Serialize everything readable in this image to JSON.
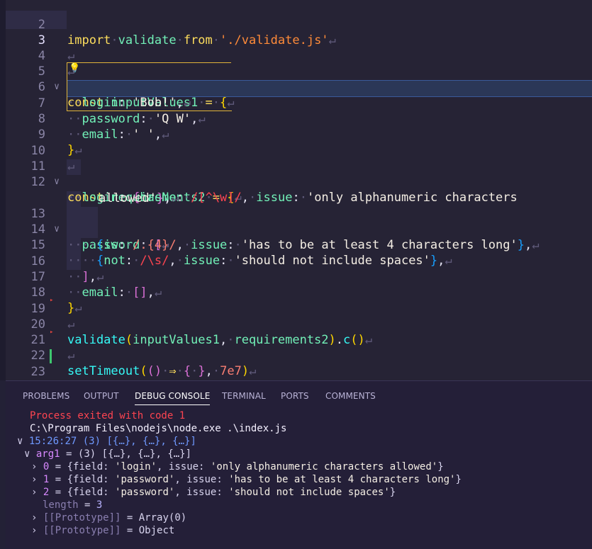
{
  "editor": {
    "lines": [
      {
        "n": "2",
        "html_key": "l2"
      },
      {
        "n": "3",
        "html_key": "l3"
      },
      {
        "n": "4",
        "html_key": "l4"
      },
      {
        "n": "5",
        "html_key": "l5"
      },
      {
        "n": "6",
        "html_key": "l6"
      },
      {
        "n": "7",
        "html_key": "l7"
      },
      {
        "n": "8",
        "html_key": "l8"
      },
      {
        "n": "9",
        "html_key": "l9"
      },
      {
        "n": "10",
        "html_key": "l10"
      },
      {
        "n": "11",
        "html_key": "l11"
      },
      {
        "n": "12",
        "html_key": "l12"
      },
      {
        "n": "13",
        "html_key": "l13"
      },
      {
        "n": "14",
        "html_key": "l14"
      },
      {
        "n": "15",
        "html_key": "l15"
      },
      {
        "n": "16",
        "html_key": "l16"
      },
      {
        "n": "17",
        "html_key": "l17"
      },
      {
        "n": "18",
        "html_key": "l18"
      },
      {
        "n": "19",
        "html_key": "l19"
      },
      {
        "n": "20",
        "html_key": "l20"
      },
      {
        "n": "21",
        "html_key": "l21"
      },
      {
        "n": "22",
        "html_key": "l22"
      },
      {
        "n": "23",
        "html_key": "l23"
      }
    ],
    "tokens": {
      "kw_import": "import",
      "id_validate": "validate",
      "kw_from": "from",
      "str_path": "'./validate.js'",
      "kw_const": "const",
      "id_input": "inputValues1",
      "id_req": "requirements2",
      "p_login": "login",
      "p_password": "password",
      "p_email": "email",
      "p_hasNo": "hasNo",
      "p_issue": "issue",
      "p_is": "is",
      "p_not": "not",
      "s_bob": "'Bob!'",
      "s_qw": "'Q W'",
      "s_space": "' '",
      "rx1": "/[^\\w]/",
      "s_alnum1": "'only alphanumeric characters",
      "s_alnum2": "allowed'",
      "rx2": "/.{4}/",
      "s_len": "'has to be at least 4 characters long'",
      "rx3": "/\\s/",
      "s_spaces": "'should not include spaces'",
      "fn_validate": "validate",
      "id_input_arg": "inputValues1",
      "id_req_arg": "requirements2",
      "fn_c": "c",
      "fn_setTimeout": "setTimeout",
      "arrow": "⇒",
      "num": "7e7"
    }
  },
  "panel": {
    "tabs": [
      "PROBLEMS",
      "OUTPUT",
      "DEBUG CONSOLE",
      "TERMINAL",
      "PORTS",
      "COMMENTS"
    ],
    "active_tab": "DEBUG CONSOLE",
    "output": {
      "exit": "Process exited with code 1",
      "cmd": "C:\\Program Files\\nodejs\\node.exe .\\index.js",
      "log_time": "15:26:27",
      "log_summary": "(3) [{…}, {…}, {…}]",
      "arg_name": "arg1",
      "arg_summary": "(3) [{…}, {…}, {…}]",
      "items": [
        {
          "idx": "0",
          "field": "'login'",
          "issue": "'only alphanumeric characters allowed'"
        },
        {
          "idx": "1",
          "field": "'password'",
          "issue": "'has to be at least 4 characters long'"
        },
        {
          "idx": "2",
          "field": "'password'",
          "issue": "'should not include spaces'"
        }
      ],
      "length_key": "length",
      "length_val": "3",
      "proto1_key": "[[Prototype]]",
      "proto1_val": "Array(0)",
      "proto2_key": "[[Prototype]]",
      "proto2_val": "Object"
    }
  },
  "colors": {
    "editor_bg": "#262335",
    "panel_bg": "#241f38",
    "keyword": "#fede5d",
    "variable": "#72f1b8",
    "string": "#ff8b39",
    "function": "#36f9f6",
    "error": "#fe4450"
  }
}
